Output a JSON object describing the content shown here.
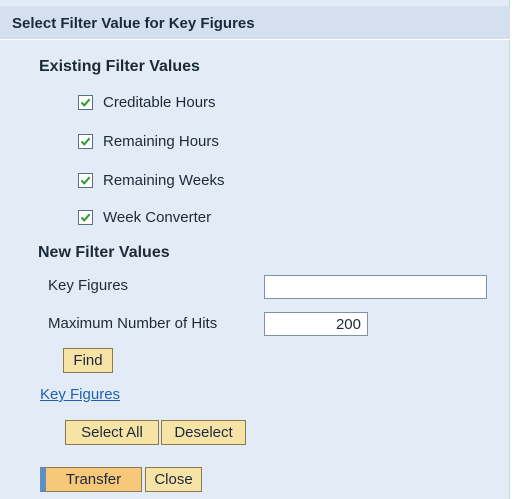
{
  "dialog": {
    "title": "Select Filter Value for Key Figures"
  },
  "existing": {
    "heading": "Existing Filter Values",
    "items": [
      {
        "label": "Creditable Hours",
        "checked": true
      },
      {
        "label": "Remaining Hours",
        "checked": true
      },
      {
        "label": "Remaining Weeks",
        "checked": true
      },
      {
        "label": "Week Converter",
        "checked": true
      }
    ]
  },
  "new_filter": {
    "heading": "New Filter Values",
    "key_figures_label": "Key Figures",
    "key_figures_value": "",
    "max_hits_label": "Maximum Number of Hits",
    "max_hits_value": "200",
    "find_label": "Find"
  },
  "key_figures_link": "Key Figures",
  "selection": {
    "select_all_label": "Select All",
    "deselect_label": "Deselect"
  },
  "footer": {
    "transfer_label": "Transfer",
    "close_label": "Close"
  },
  "colors": {
    "panel_bg": "#e3ecf6",
    "title_bg": "#d4e0ee",
    "button_bg": "#f8e3a6",
    "primary_button_bg": "#f7c77a",
    "primary_button_accent": "#5f8ec0",
    "link": "#1f5fb3",
    "checkmark": "#2f9a2f"
  },
  "icons": {
    "checkbox_mark": "checkmark-icon"
  }
}
